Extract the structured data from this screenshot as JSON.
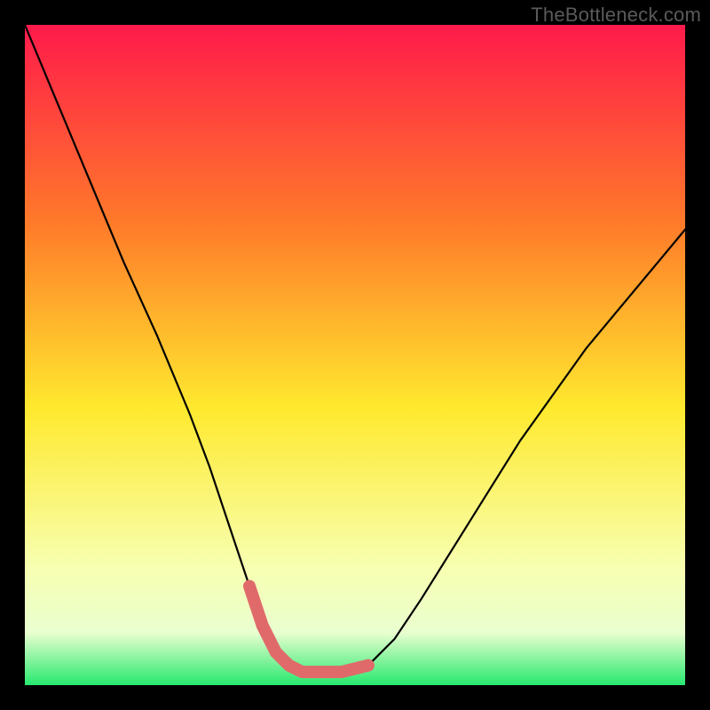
{
  "attribution": "TheBottleneck.com",
  "colors": {
    "background": "#000000",
    "gradient_top": "#ff1a4b",
    "gradient_upper_mid": "#ff7a2a",
    "gradient_mid": "#ffe92e",
    "gradient_lower_mid": "#f7ffb0",
    "gradient_band_pale": "#eaffd0",
    "gradient_bottom": "#27e86f",
    "curve": "#000000",
    "marker": "#e06a6a"
  },
  "chart_data": {
    "type": "line",
    "title": "",
    "xlabel": "",
    "ylabel": "",
    "xlim": [
      0,
      100
    ],
    "ylim": [
      0,
      100
    ],
    "series": [
      {
        "name": "bottleneck-curve",
        "x": [
          0,
          5,
          10,
          15,
          20,
          25,
          28,
          31,
          34,
          36,
          38,
          40,
          42,
          45,
          48,
          52,
          56,
          60,
          65,
          70,
          75,
          80,
          85,
          90,
          95,
          100
        ],
        "y": [
          100,
          88,
          76,
          64,
          53,
          41,
          33,
          24,
          15,
          9,
          5,
          3,
          2,
          2,
          2,
          3,
          7,
          13,
          21,
          29,
          37,
          44,
          51,
          57,
          63,
          69
        ]
      }
    ],
    "marker_region": {
      "name": "optimal-zone",
      "x": [
        34,
        36,
        38,
        40,
        42,
        45,
        48,
        52
      ],
      "y": [
        15,
        9,
        5,
        3,
        2,
        2,
        2,
        3,
        7
      ]
    },
    "annotations": []
  }
}
